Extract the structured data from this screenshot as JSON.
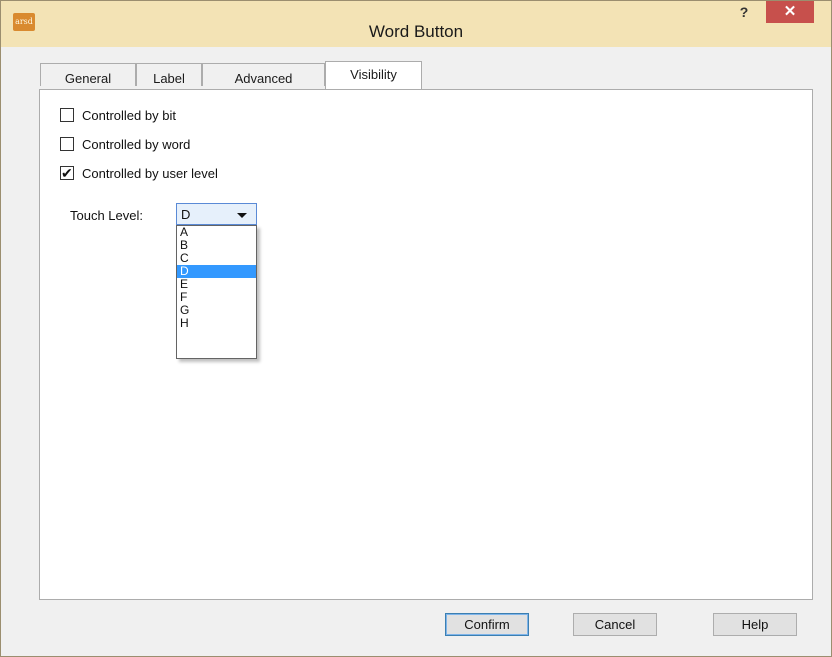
{
  "window": {
    "title": "Word Button",
    "app_icon_text": "arsd",
    "help_label": "?",
    "close_label": "✕"
  },
  "tabs": [
    {
      "label": "General"
    },
    {
      "label": "Label"
    },
    {
      "label": "Advanced"
    },
    {
      "label": "Visibility",
      "active": true
    }
  ],
  "checkboxes": [
    {
      "label": "Controlled by bit",
      "checked": false
    },
    {
      "label": "Controlled by word",
      "checked": false
    },
    {
      "label": "Controlled by user level",
      "checked": true
    }
  ],
  "touch_level": {
    "label": "Touch Level:",
    "value": "D",
    "options": [
      "A",
      "B",
      "C",
      "D",
      "E",
      "F",
      "G",
      "H"
    ],
    "selected_option": "D"
  },
  "buttons": {
    "confirm": "Confirm",
    "cancel": "Cancel",
    "help": "Help"
  },
  "icons": {
    "check": "✔"
  }
}
